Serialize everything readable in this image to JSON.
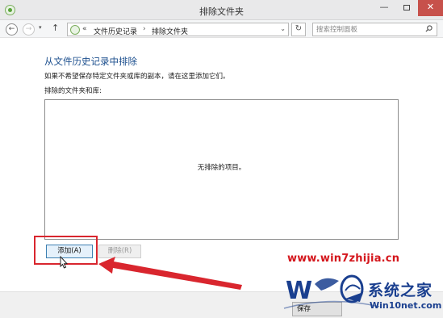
{
  "window": {
    "title": "排除文件夹",
    "minimize_label": "—",
    "close_label": "✕"
  },
  "nav": {
    "back_glyph": "←",
    "forward_glyph": "→",
    "recent_glyph": "▾",
    "up_glyph": "↑",
    "breadcrumb": {
      "overflow": "«",
      "items": [
        "文件历史记录",
        "排除文件夹"
      ],
      "separator": "›",
      "dropdown_glyph": "⌄"
    },
    "refresh_glyph": "↻",
    "search_placeholder": "搜索控制面板"
  },
  "content": {
    "heading": "从文件历史记录中排除",
    "description": "如果不希望保存特定文件夹或库的副本，请在这里添加它们。",
    "list_label": "排除的文件夹和库:",
    "empty_message": "无排除的项目。",
    "add_button": "添加(A)",
    "remove_button": "删除(R)"
  },
  "footer": {
    "save_button": "保存"
  },
  "watermark": {
    "url": "www.win7zhijia.cn",
    "brand": "系统之家",
    "sub": "Win10net.com"
  },
  "colors": {
    "heading": "#1c4f8e",
    "highlight": "#d9262e",
    "close_button": "#c7514b",
    "watermark_url": "#d4161c",
    "watermark_brand": "#1a3f8f"
  }
}
